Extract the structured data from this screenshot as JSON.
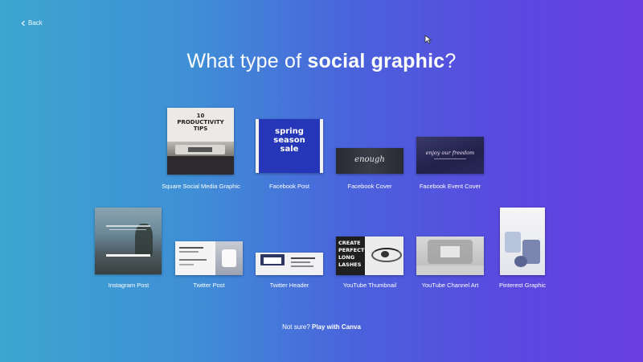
{
  "nav": {
    "back_label": "Back"
  },
  "header": {
    "prefix": "What type of ",
    "emphasis": "social graphic",
    "suffix": "?"
  },
  "designs": [
    {
      "label": "Square Social Media Graphic",
      "thumb_text": [
        "10",
        "PRODUCTIVITY",
        "TIPS"
      ]
    },
    {
      "label": "Facebook Post",
      "thumb_text": [
        "spring",
        "season",
        "sale"
      ]
    },
    {
      "label": "Facebook Cover",
      "thumb_text": [
        "enough"
      ]
    },
    {
      "label": "Facebook Event Cover",
      "thumb_text": [
        "enjoy our freedom"
      ]
    },
    {
      "label": "Instagram Post"
    },
    {
      "label": "Twitter Post"
    },
    {
      "label": "Twitter Header"
    },
    {
      "label": "YouTube Thumbnail",
      "thumb_text": [
        "CREATE",
        "PERFECT",
        "LONG",
        "LASHES"
      ]
    },
    {
      "label": "YouTube Channel Art"
    },
    {
      "label": "Pinterest Graphic"
    }
  ],
  "footer": {
    "prefix": "Not sure? ",
    "link": "Play with Canva"
  },
  "colors": {
    "gradient_start": "#3ca6cf",
    "gradient_end": "#6a3ee0",
    "facebook_post_blue": "#2536b8"
  }
}
